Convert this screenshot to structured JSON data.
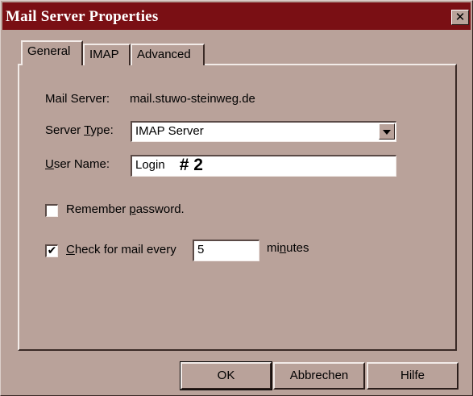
{
  "window": {
    "title": "Mail Server Properties",
    "close_glyph": "✕"
  },
  "tabs": [
    {
      "label": "General",
      "active": true
    },
    {
      "label": "IMAP",
      "active": false
    },
    {
      "label": "Advanced",
      "active": false
    }
  ],
  "general": {
    "mail_server_label": "Mail Server:",
    "mail_server_value": "mail.stuwo-steinweg.de",
    "server_type_label_pre": "Server ",
    "server_type_label_accel": "T",
    "server_type_label_post": "ype:",
    "server_type_value": "IMAP Server",
    "user_name_label_accel": "U",
    "user_name_label_post": "ser Name:",
    "user_name_value": "Login",
    "user_name_annotation": "# 2",
    "remember_label_pre": "Remember ",
    "remember_label_accel": "p",
    "remember_label_post": "assword.",
    "remember_checked": false,
    "check_label_accel": "C",
    "check_label_post": "heck for mail every",
    "check_checked": true,
    "check_check_glyph": "✔",
    "interval_value": "5",
    "minutes_pre": "mi",
    "minutes_accel": "n",
    "minutes_post": "utes"
  },
  "buttons": {
    "ok": "OK",
    "cancel": "Abbrechen",
    "help": "Hilfe"
  },
  "icons": {
    "close": "close-icon",
    "dropdown": "chevron-down-icon",
    "check": "checkmark-icon"
  }
}
